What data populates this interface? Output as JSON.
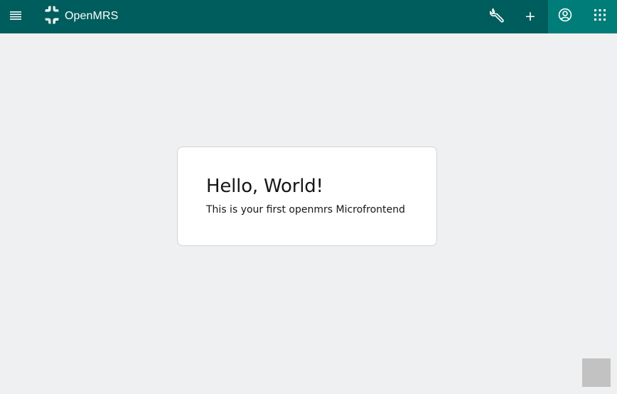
{
  "header": {
    "brand_name": "OpenMRS",
    "menu_icon": "hamburger-menu-icon",
    "actions": {
      "system_admin_icon": "wrench-icon",
      "add_icon": "plus-icon",
      "add_label": "+",
      "user_icon": "user-avatar-icon",
      "app_switcher_icon": "app-grid-icon"
    },
    "colors": {
      "bar": "#005d5d",
      "active": "#007d79"
    }
  },
  "card": {
    "title": "Hello, World!",
    "subtitle": "This is your first openmrs Microfrontend"
  },
  "page": {
    "background": "#eff0f2"
  }
}
